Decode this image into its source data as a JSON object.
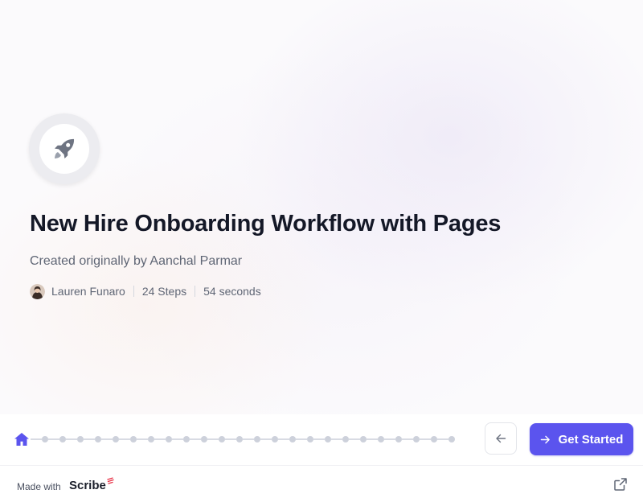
{
  "hero": {
    "title": "New Hire Onboarding Workflow with Pages",
    "subtitle": "Created originally by Aanchal Parmar",
    "author": "Lauren Funaro",
    "steps": "24 Steps",
    "duration": "54 seconds",
    "logo_icon": "rocket-icon"
  },
  "progress": {
    "current_step": 0,
    "step_dots": 24,
    "active_color": "#5b54ee",
    "dot_color": "#cdd1db"
  },
  "navigation": {
    "back_icon": "arrow-left-icon",
    "start_label": "Get Started",
    "start_icon": "arrow-right-icon",
    "accent": "#5b54ee"
  },
  "footer": {
    "made_with": "Made with",
    "brand": "Scribe",
    "external_icon": "external-link-icon"
  }
}
